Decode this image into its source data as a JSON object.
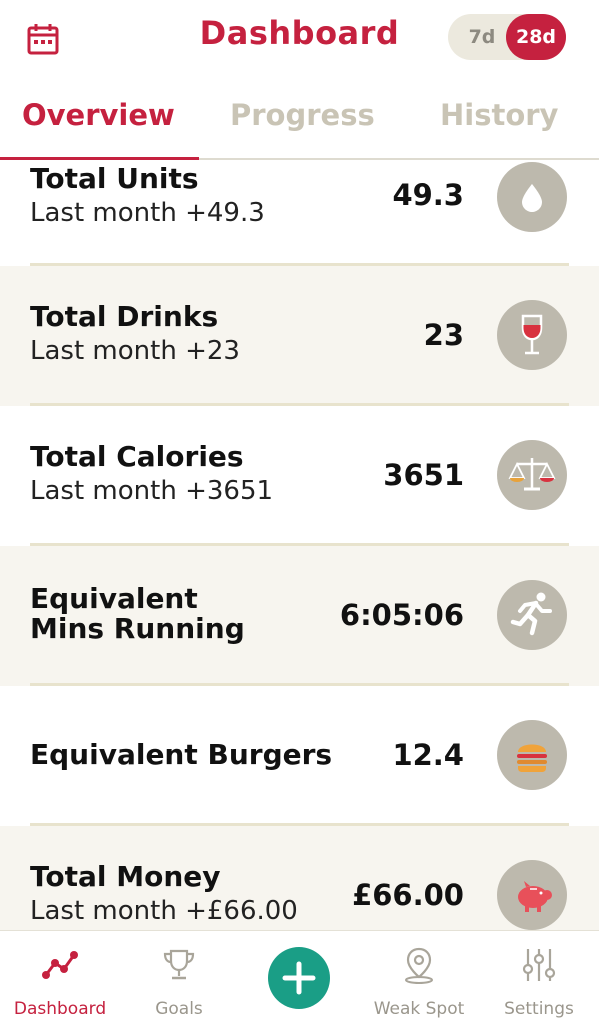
{
  "header": {
    "title": "Dashboard",
    "range_options": [
      "7d",
      "28d"
    ],
    "range_selected": "28d"
  },
  "tabs": [
    {
      "label": "Overview",
      "active": true
    },
    {
      "label": "Progress",
      "active": false
    },
    {
      "label": "History",
      "active": false
    }
  ],
  "stats": [
    {
      "label": "Total Units",
      "sub": "Last month +49.3",
      "value": "49.3",
      "icon": "water-drop-icon"
    },
    {
      "label": "Total Drinks",
      "sub": "Last month +23",
      "value": "23",
      "icon": "wine-glass-icon"
    },
    {
      "label": "Total Calories",
      "sub": "Last month +3651",
      "value": "3651",
      "icon": "scales-icon"
    },
    {
      "label_line1": "Equivalent",
      "label_line2": "Mins Running",
      "value": "6:05:06",
      "icon": "runner-icon"
    },
    {
      "label": "Equivalent Burgers",
      "value": "12.4",
      "icon": "burger-icon"
    },
    {
      "label": "Total Money",
      "sub": "Last month +£66.00",
      "value": "£66.00",
      "icon": "piggy-bank-icon"
    }
  ],
  "bottom_nav": [
    {
      "label": "Dashboard",
      "icon": "chart-line-icon",
      "active": true
    },
    {
      "label": "Goals",
      "icon": "trophy-icon",
      "active": false
    },
    {
      "label": "",
      "icon": "plus-icon",
      "active": false
    },
    {
      "label": "Weak Spot",
      "icon": "map-pin-icon",
      "active": false
    },
    {
      "label": "Settings",
      "icon": "sliders-icon",
      "active": false
    }
  ],
  "colors": {
    "brand": "#c5213f",
    "add_button": "#1a9e86",
    "badge": "#bdb9ad",
    "alt_row": "#f7f5ef"
  }
}
